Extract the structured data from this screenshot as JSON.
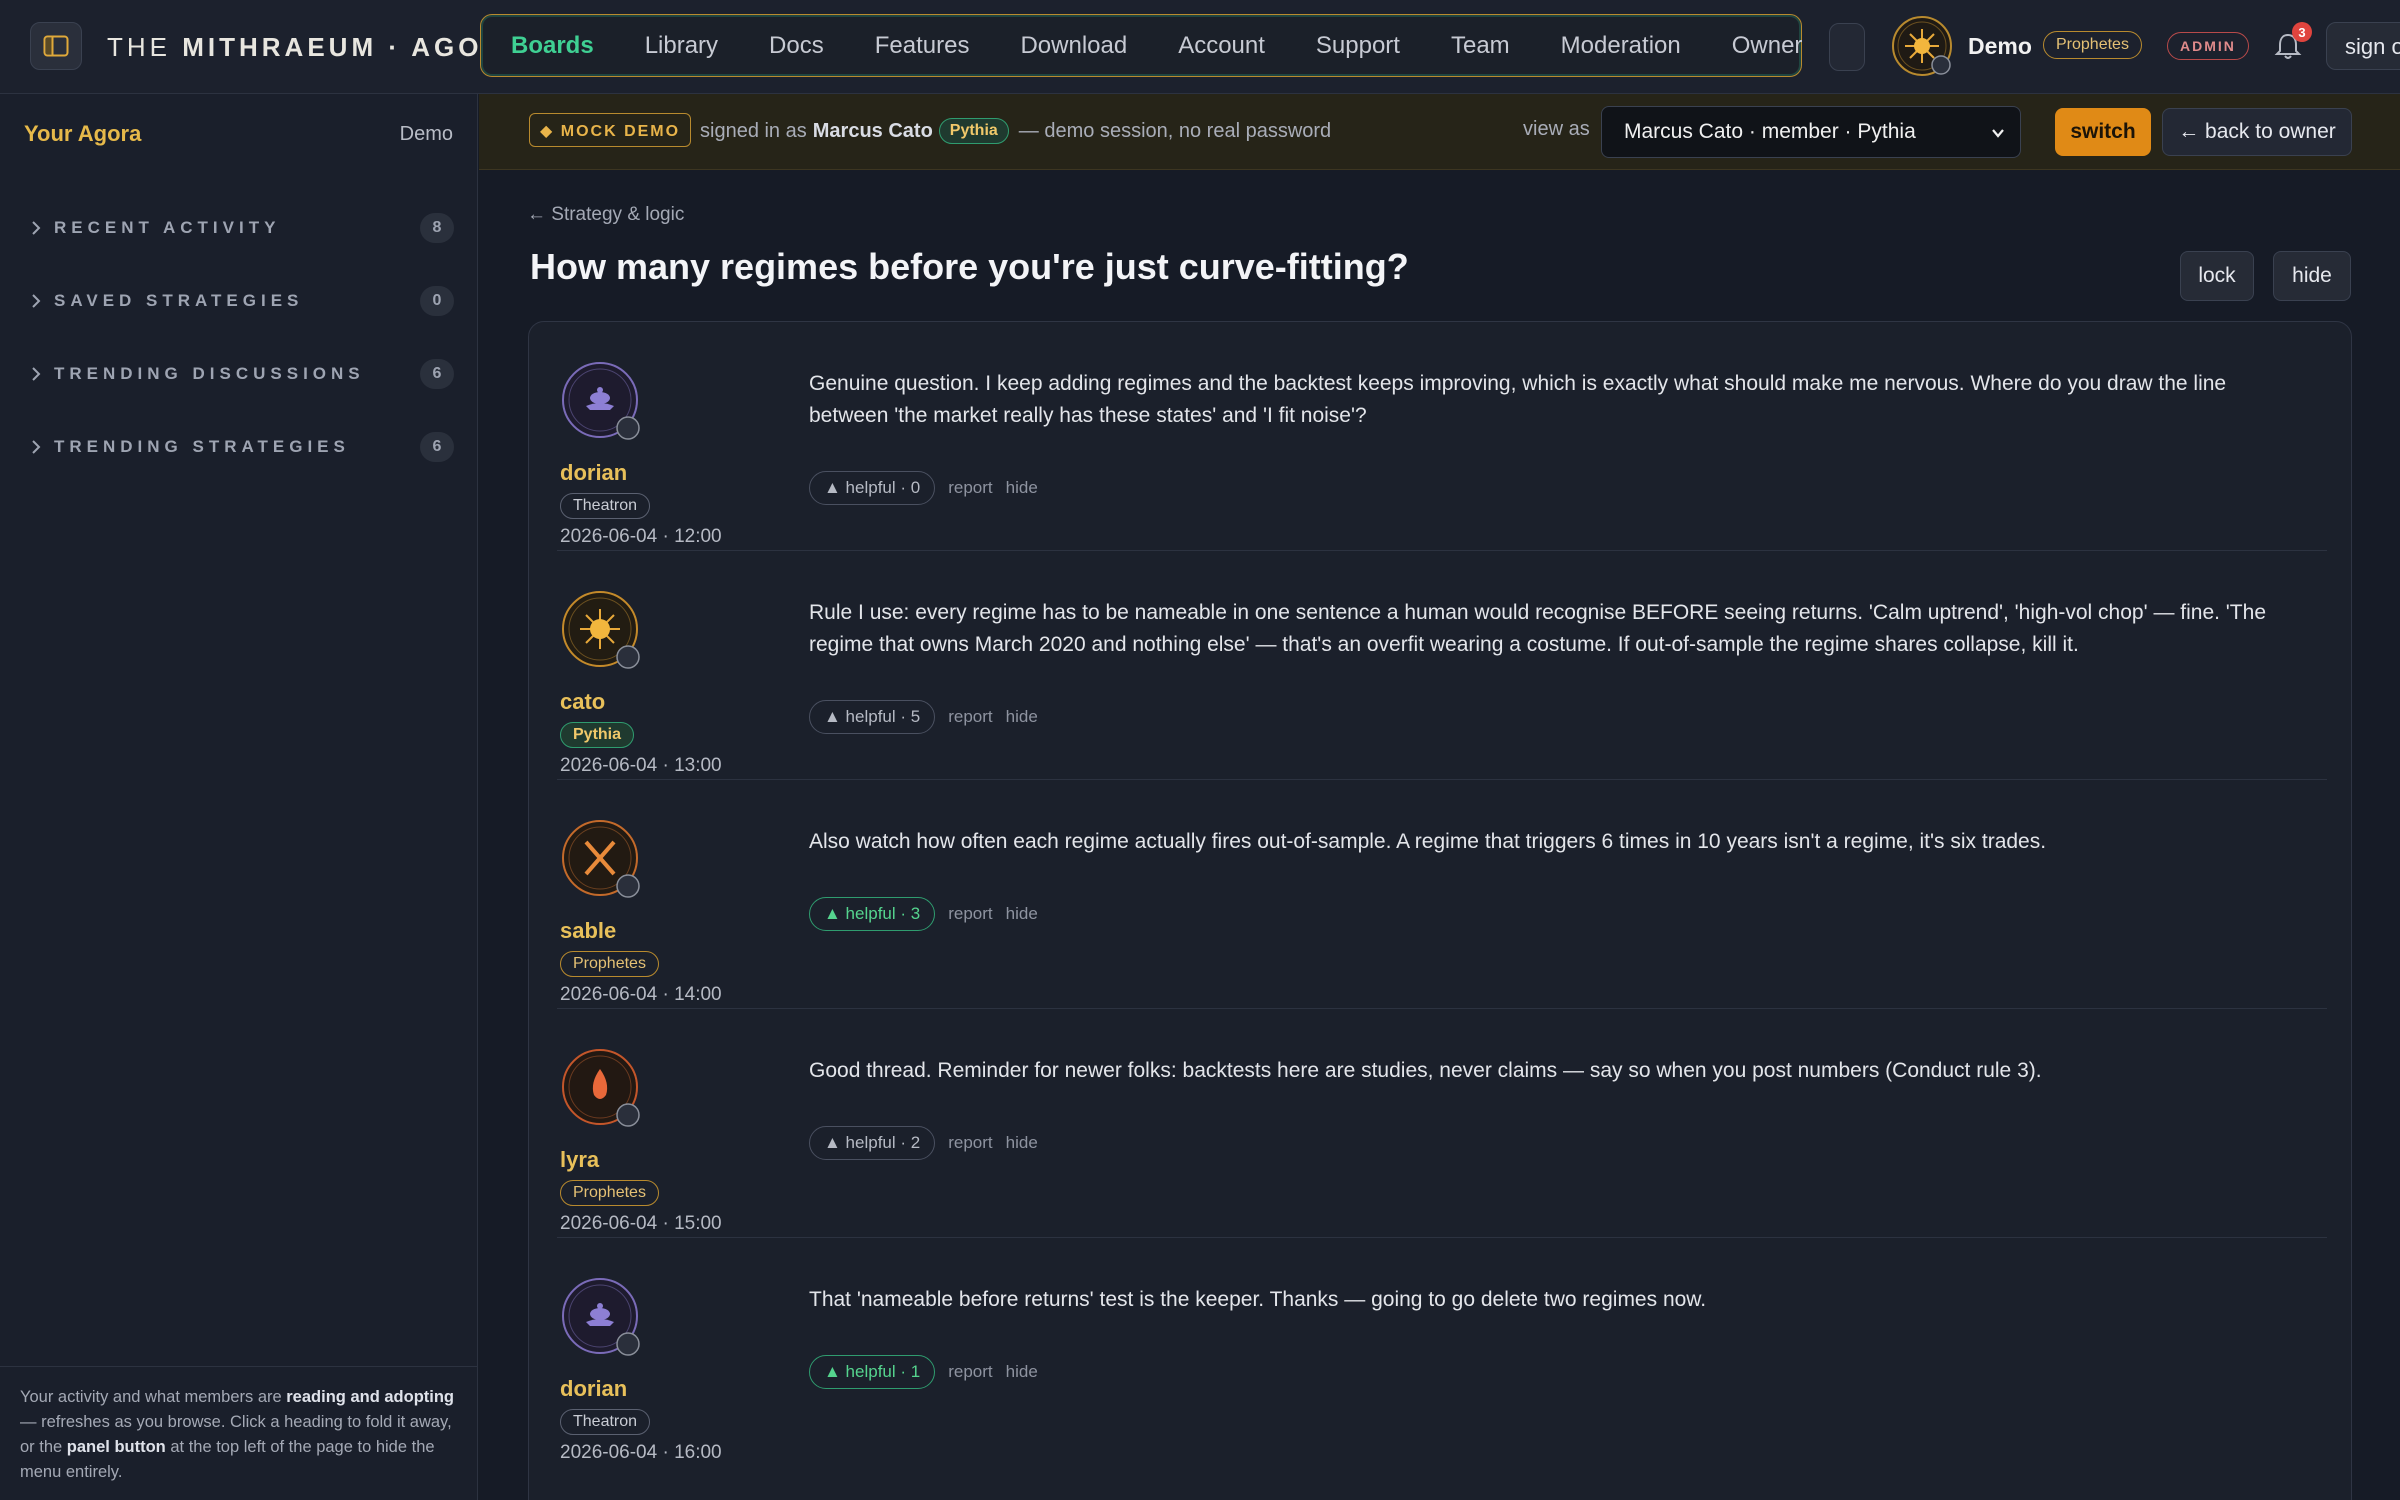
{
  "header": {
    "brand_prefix": "THE ",
    "brand_bold": "MITHRAEUM · AGORA",
    "nav": [
      "Boards",
      "Library",
      "Docs",
      "Features",
      "Download",
      "Account",
      "Support",
      "Team",
      "Moderation",
      "Owner"
    ],
    "active_nav": "Boards",
    "user_name": "Demo",
    "user_badge": "Prophetes",
    "admin_badge": "ADMIN",
    "notifications": "3",
    "signout_label": "sign out"
  },
  "sidebar": {
    "title": "Your Agora",
    "user": "Demo",
    "sections": [
      {
        "label": "RECENT ACTIVITY",
        "count": "8"
      },
      {
        "label": "SAVED STRATEGIES",
        "count": "0"
      },
      {
        "label": "TRENDING DISCUSSIONS",
        "count": "6"
      },
      {
        "label": "TRENDING STRATEGIES",
        "count": "6"
      }
    ],
    "footer_parts": [
      "Your activity and what members are ",
      "reading and adopting",
      " — refreshes as you browse. Click a heading to fold it away, or the ",
      "panel button",
      " at the top left of the page to hide the menu entirely."
    ]
  },
  "banner": {
    "mock_label": "◆ MOCK DEMO",
    "signed_prefix": "signed in as",
    "signed_user": "Marcus Cato",
    "signed_badge": "Pythia",
    "signed_suffix": "— demo session, no real password",
    "view_as_label": "view as",
    "view_as_value": "Marcus Cato · member · Pythia",
    "switch_label": "switch",
    "back_label": "← back to owner"
  },
  "thread": {
    "breadcrumb": "← Strategy & logic",
    "title": "How many regimes before you're just curve-fitting?",
    "lock_label": "lock",
    "hide_label": "hide",
    "posts": [
      {
        "author": "dorian",
        "role": "Theatron",
        "date": "2026-06-04 · 12:00",
        "body": "Genuine question. I keep adding regimes and the backtest keeps improving, which is exactly what should make me nervous. Where do you draw the line between 'the market really has these states' and 'I fit noise'?",
        "helpful": "▲ helpful · 0",
        "report": "report",
        "hide": "hide"
      },
      {
        "author": "cato",
        "role": "Pythia",
        "date": "2026-06-04 · 13:00",
        "body": "Rule I use: every regime has to be nameable in one sentence a human would recognise BEFORE seeing returns. 'Calm uptrend', 'high-vol chop' — fine. 'The regime that owns March 2020 and nothing else' — that's an overfit wearing a costume. If out-of-sample the regime shares collapse, kill it.",
        "helpful": "▲ helpful · 5",
        "report": "report",
        "hide": "hide"
      },
      {
        "author": "sable",
        "role": "Prophetes",
        "date": "2026-06-04 · 14:00",
        "body": "Also watch how often each regime actually fires out-of-sample. A regime that triggers 6 times in 10 years isn't a regime, it's six trades.",
        "helpful": "▲ helpful · 3",
        "report": "report",
        "hide": "hide"
      },
      {
        "author": "lyra",
        "role": "Prophetes",
        "date": "2026-06-04 · 15:00",
        "body": "Good thread. Reminder for newer folks: backtests here are studies, never claims — say so when you post numbers (Conduct rule 3).",
        "helpful": "▲ helpful · 2",
        "report": "report",
        "hide": "hide"
      },
      {
        "author": "dorian",
        "role": "Theatron",
        "date": "2026-06-04 · 16:00",
        "body": "That 'nameable before returns' test is the keeper. Thanks — going to go delete two regimes now.",
        "helpful": "▲ helpful · 1",
        "report": "report",
        "hide": "hide"
      }
    ]
  },
  "colors": {
    "accent_gold": "#e8c05a",
    "accent_green": "#3fd093",
    "switch_orange": "#e08a16",
    "admin_red": "#e08b8b"
  },
  "icons": {
    "panel": "panel-toggle-icon",
    "bell": "bell-icon",
    "chevron": "chevron-right-icon"
  }
}
